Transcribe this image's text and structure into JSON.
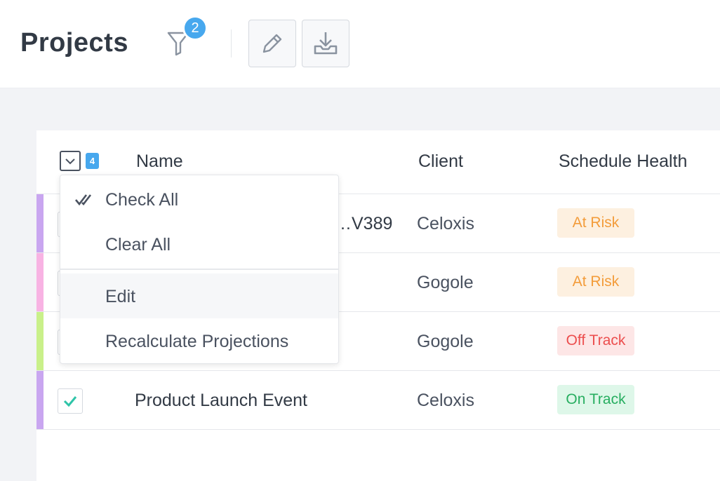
{
  "header": {
    "title": "Projects",
    "filter_count": "2",
    "filter_icon": "funnel-icon",
    "edit_icon": "pencil-icon",
    "download_icon": "download-tray-icon"
  },
  "table": {
    "selected_count": "4",
    "columns": {
      "name": "Name",
      "client": "Client",
      "health": "Schedule Health"
    },
    "rows": [
      {
        "name": "…V389",
        "client": "Celoxis",
        "health": "At Risk",
        "stripe": "#c9a6f0",
        "checked": false
      },
      {
        "name": "",
        "client": "Gogole",
        "health": "At Risk",
        "stripe": "#f8b3e3",
        "checked": false
      },
      {
        "name": "",
        "client": "Gogole",
        "health": "Off Track",
        "stripe": "#c9f08a",
        "checked": false
      },
      {
        "name": "Product Launch Event",
        "client": "Celoxis",
        "health": "On Track",
        "stripe": "#c9a6f0",
        "checked": true
      }
    ]
  },
  "menu": {
    "items": [
      "Check All",
      "Clear All",
      "Edit",
      "Recalculate Projections"
    ]
  },
  "colors": {
    "accent": "#47a8ee",
    "at_risk_bg": "#fdf0e0",
    "at_risk_fg": "#f39c3a",
    "off_track_bg": "#fde6e6",
    "off_track_fg": "#ec4e4e",
    "on_track_bg": "#def7e9",
    "on_track_fg": "#27ae60",
    "check_green": "#2ec4a8"
  }
}
